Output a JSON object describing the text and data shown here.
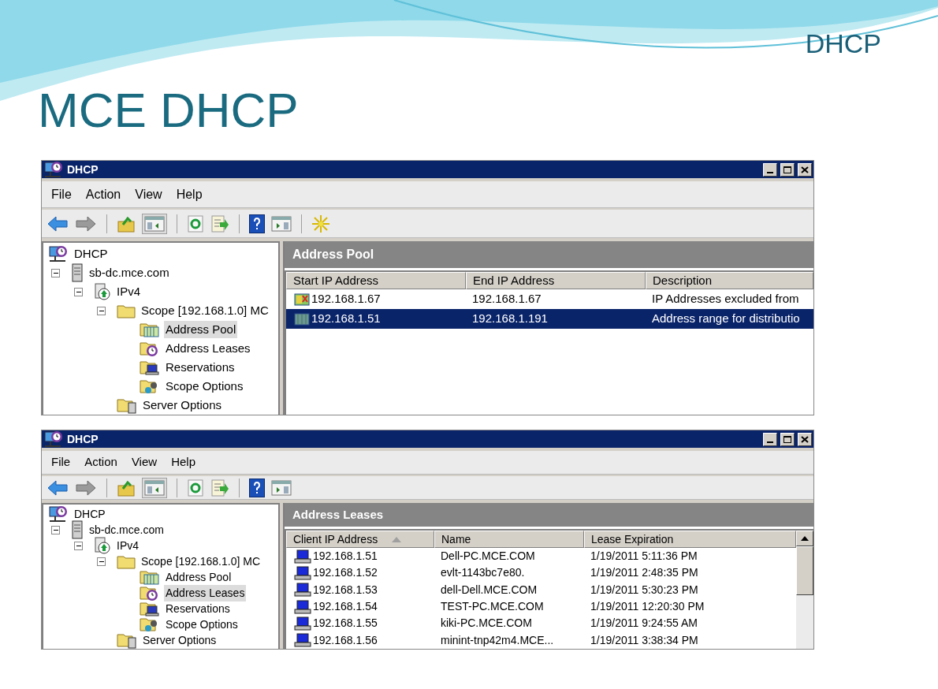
{
  "slide": {
    "corner_label": "DHCP",
    "title": "MCE DHCP"
  },
  "windows": [
    {
      "title": "DHCP",
      "menu": [
        "File",
        "Action",
        "View",
        "Help"
      ],
      "toolbar": [
        {
          "kind": "back"
        },
        {
          "kind": "forward"
        },
        {
          "kind": "sep"
        },
        {
          "kind": "up"
        },
        {
          "kind": "tree",
          "selected": true
        },
        {
          "kind": "sep"
        },
        {
          "kind": "refresh"
        },
        {
          "kind": "export"
        },
        {
          "kind": "sep"
        },
        {
          "kind": "help"
        },
        {
          "kind": "action"
        },
        {
          "kind": "sep"
        },
        {
          "kind": "star"
        }
      ],
      "tree": [
        {
          "label": "DHCP",
          "kind": "dhcp",
          "selected": false,
          "children": [
            {
              "label": "sb-dc.mce.com",
              "kind": "server",
              "expanded": true,
              "selected": false,
              "children": [
                {
                  "label": "IPv4",
                  "kind": "ipv4",
                  "expanded": true,
                  "selected": false,
                  "children": [
                    {
                      "label": "Scope [192.168.1.0] MC",
                      "kind": "folder",
                      "expanded": true,
                      "selected": false,
                      "children": [
                        {
                          "label": "Address Pool",
                          "kind": "pool",
                          "selected": true
                        },
                        {
                          "label": "Address Leases",
                          "kind": "leases",
                          "selected": false
                        },
                        {
                          "label": "Reservations",
                          "kind": "reservations",
                          "selected": false
                        },
                        {
                          "label": "Scope Options",
                          "kind": "options",
                          "selected": false
                        }
                      ]
                    },
                    {
                      "label": "Server Options",
                      "kind": "serveroptions",
                      "selected": false
                    }
                  ]
                }
              ]
            }
          ]
        }
      ],
      "pane": {
        "title": "Address Pool",
        "columns": [
          {
            "label": "Start IP Address",
            "sorted": false
          },
          {
            "label": "End IP Address",
            "sorted": false
          },
          {
            "label": "Description",
            "sorted": false
          }
        ],
        "rows": [
          {
            "kind": "excluded",
            "selected": false,
            "cells": [
              "192.168.1.67",
              "192.168.1.67",
              "IP Addresses excluded from"
            ]
          },
          {
            "kind": "range",
            "selected": true,
            "cells": [
              "192.168.1.51",
              "192.168.1.191",
              "Address range for distributio"
            ]
          }
        ]
      }
    },
    {
      "title": "DHCP",
      "menu": [
        "File",
        "Action",
        "View",
        "Help"
      ],
      "toolbar": [
        {
          "kind": "back"
        },
        {
          "kind": "forward"
        },
        {
          "kind": "sep"
        },
        {
          "kind": "up"
        },
        {
          "kind": "tree",
          "selected": true
        },
        {
          "kind": "sep"
        },
        {
          "kind": "refresh"
        },
        {
          "kind": "export"
        },
        {
          "kind": "sep"
        },
        {
          "kind": "help"
        },
        {
          "kind": "action"
        }
      ],
      "tree": [
        {
          "label": "DHCP",
          "kind": "dhcp",
          "selected": false,
          "children": [
            {
              "label": "sb-dc.mce.com",
              "kind": "server",
              "expanded": true,
              "selected": false,
              "children": [
                {
                  "label": "IPv4",
                  "kind": "ipv4",
                  "expanded": true,
                  "selected": false,
                  "children": [
                    {
                      "label": "Scope [192.168.1.0] MC",
                      "kind": "folder",
                      "expanded": true,
                      "selected": false,
                      "children": [
                        {
                          "label": "Address Pool",
                          "kind": "pool",
                          "selected": false
                        },
                        {
                          "label": "Address Leases",
                          "kind": "leases",
                          "selected": true
                        },
                        {
                          "label": "Reservations",
                          "kind": "reservations",
                          "selected": false
                        },
                        {
                          "label": "Scope Options",
                          "kind": "options",
                          "selected": false
                        }
                      ]
                    },
                    {
                      "label": "Server Options",
                      "kind": "serveroptions",
                      "selected": false
                    }
                  ]
                }
              ]
            }
          ]
        }
      ],
      "pane": {
        "title": "Address Leases",
        "columns": [
          {
            "label": "Client IP Address",
            "sorted": true
          },
          {
            "label": "Name",
            "sorted": false
          },
          {
            "label": "Lease Expiration",
            "sorted": false
          }
        ],
        "rows": [
          {
            "kind": "computer",
            "selected": false,
            "cells": [
              "192.168.1.51",
              "Dell-PC.MCE.COM",
              "1/19/2011 5:11:36 PM"
            ]
          },
          {
            "kind": "computer",
            "selected": false,
            "cells": [
              "192.168.1.52",
              "evlt-1143bc7e80.",
              "1/19/2011 2:48:35 PM"
            ]
          },
          {
            "kind": "computer",
            "selected": false,
            "cells": [
              "192.168.1.53",
              "dell-Dell.MCE.COM",
              "1/19/2011 5:30:23 PM"
            ]
          },
          {
            "kind": "computer",
            "selected": false,
            "cells": [
              "192.168.1.54",
              "TEST-PC.MCE.COM",
              "1/19/2011 12:20:30 PM"
            ]
          },
          {
            "kind": "computer",
            "selected": false,
            "cells": [
              "192.168.1.55",
              "kiki-PC.MCE.COM",
              "1/19/2011 9:24:55 AM"
            ]
          },
          {
            "kind": "computer",
            "selected": false,
            "cells": [
              "192.168.1.56",
              "minint-tnp42m4.MCE...",
              "1/19/2011 3:38:34 PM"
            ]
          }
        ]
      }
    }
  ]
}
